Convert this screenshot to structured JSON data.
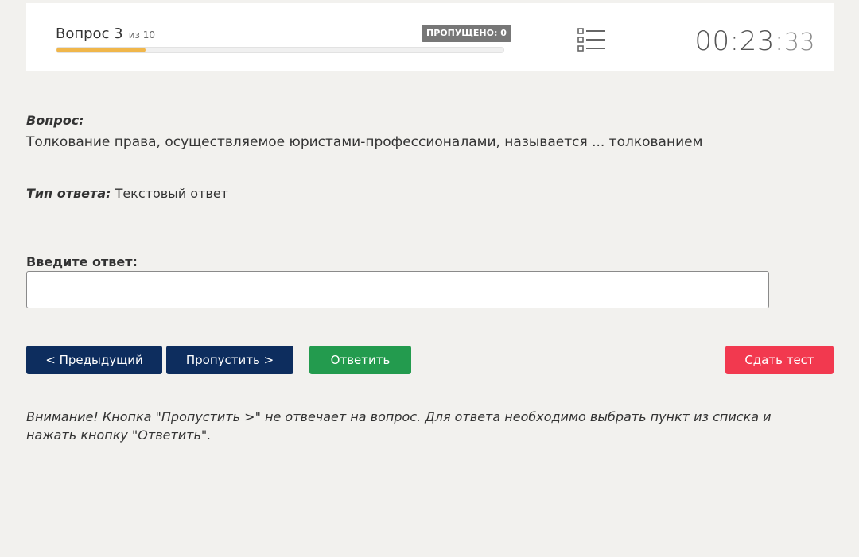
{
  "header": {
    "question_label": "Вопрос 3",
    "question_of": "из 10",
    "skipped_badge": "ПРОПУЩЕНО: 0",
    "progress": 0.2,
    "timer_main": "00:23:",
    "timer_seconds": "33",
    "list_icon": "list-icon"
  },
  "question": {
    "heading": "Вопрос:",
    "text": "Толкование права, осуществляемое юристами-профессионалами, называется ... толкованием"
  },
  "answer_type": {
    "label": "Тип ответа:",
    "value": "Текстовый ответ"
  },
  "answer_input": {
    "label": "Введите ответ:",
    "value": "",
    "placeholder": ""
  },
  "buttons": {
    "prev": "< Предыдущий",
    "skip": "Пропустить >",
    "answer": "Ответить",
    "submit": "Сдать тест"
  },
  "notice": "Внимание! Кнопка \"Пропустить >\" не отвечает на вопрос. Для ответа необходимо выбрать пункт из списка и нажать кнопку \"Ответить\".",
  "colors": {
    "progress_fill": "#f0b64a",
    "nav_button": "#0d2d5e",
    "answer_button": "#239b4e",
    "submit_button": "#f2394f",
    "badge": "#777777"
  }
}
